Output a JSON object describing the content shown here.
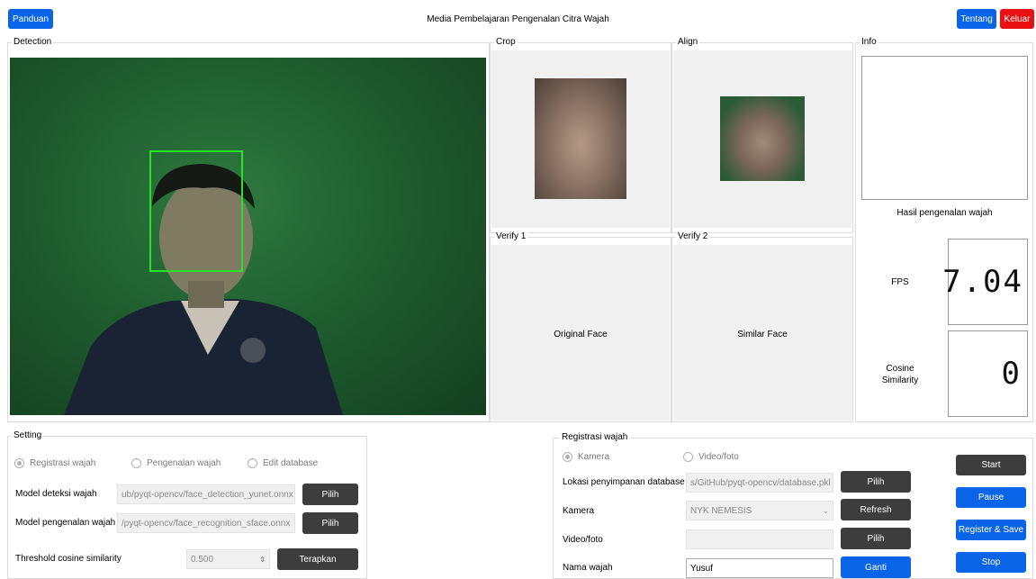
{
  "header": {
    "title": "Media Pembelajaran Pengenalan Citra Wajah",
    "guide_label": "Panduan",
    "about_label": "Tentang",
    "exit_label": "Keluar"
  },
  "panels": {
    "detection": "Detection",
    "crop": "Crop",
    "align": "Align",
    "info": "Info",
    "verify1": "Verify 1",
    "verify2": "Verify 2",
    "original_face": "Original Face",
    "similar_face": "Similar Face"
  },
  "info": {
    "result_label": "Hasil pengenalan wajah",
    "fps_label": "FPS",
    "fps_value": "7.04",
    "cosine_label_line1": "Cosine",
    "cosine_label_line2": "Similarity",
    "cosine_value": "0"
  },
  "setting": {
    "title": "Setting",
    "modes": [
      {
        "label": "Registrasi wajah",
        "selected": true
      },
      {
        "label": "Pengenalan wajah",
        "selected": false
      },
      {
        "label": "Edit database",
        "selected": false
      }
    ],
    "detection_model_label": "Model deteksi wajah",
    "detection_model_value": "ub/pyqt-opencv/face_detection_yunet.onnx",
    "recognition_model_label": "Model pengenalan wajah",
    "recognition_model_value": "/pyqt-opencv/face_recognition_sface.onnx",
    "threshold_label": "Threshold cosine similarity",
    "threshold_value": "0.500",
    "choose_label": "Pilih",
    "apply_label": "Terapkan"
  },
  "registration": {
    "title": "Registrasi wajah",
    "sources": [
      {
        "label": "Kamera",
        "selected": true
      },
      {
        "label": "Video/foto",
        "selected": false
      }
    ],
    "db_location_label": "Lokasi penyimpanan database",
    "db_location_value": "s/GitHub/pyqt-opencv/database.pkl",
    "camera_label": "Kamera",
    "camera_value": "NYK NEMESIS",
    "video_label": "Video/foto",
    "video_value": "",
    "name_label": "Nama wajah",
    "name_value": "Yusuf",
    "choose_label": "Pilih",
    "refresh_label": "Refresh",
    "change_label": "Ganti",
    "start_label": "Start",
    "pause_label": "Pause",
    "register_label": "Register & Save",
    "stop_label": "Stop"
  }
}
